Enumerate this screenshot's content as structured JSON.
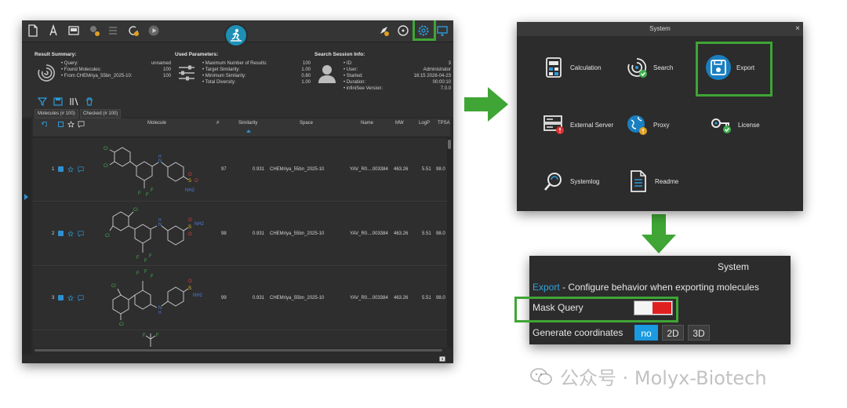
{
  "app": {
    "summary": {
      "result_heading": "Result Summary:",
      "result_rows": [
        {
          "key": "Query:",
          "value": "unnamed"
        },
        {
          "key": "Found Molecules:",
          "value": "100"
        },
        {
          "key": "From CHEMriya_55bn_2025-10:",
          "value": "100"
        }
      ],
      "params_heading": "Used Parameters:",
      "params_rows": [
        {
          "key": "Maximum Number of Results:",
          "value": "100"
        },
        {
          "key": "Target Similarity:",
          "value": "1.00"
        },
        {
          "key": "Minimum Similarity:",
          "value": "0.80"
        },
        {
          "key": "Total Diversity:",
          "value": "1.00"
        }
      ],
      "session_heading": "Search Session Info:",
      "session_rows": [
        {
          "key": "ID:",
          "value": "3"
        },
        {
          "key": "User:",
          "value": "Administrator"
        },
        {
          "key": "Started:",
          "value": "16:15 2026-04-23"
        },
        {
          "key": "Duration:",
          "value": "00:00:10"
        },
        {
          "key": "infiniSee Version:",
          "value": "7.0.0"
        }
      ]
    },
    "tabs": [
      "Molecules (# 100)",
      "Checked (# 100)"
    ],
    "columns": {
      "molecule": "Molecule",
      "index": "#",
      "similarity": "Similarity",
      "space": "Space",
      "name": "Name",
      "mw": "MW",
      "logp": "LogP",
      "tpsa": "TPSA"
    },
    "rows": [
      {
        "row_no": "1",
        "index": "97",
        "similarity": "0.931",
        "space": "CHEMriya_55bn_2025-10",
        "name": "YAV_R0....003384",
        "mw": "463.26",
        "logp": "5.51",
        "tpsa": "98.0"
      },
      {
        "row_no": "2",
        "index": "98",
        "similarity": "0.931",
        "space": "CHEMriya_55bn_2025-10",
        "name": "YAV_R0....003384",
        "mw": "463.26",
        "logp": "5.51",
        "tpsa": "98.0"
      },
      {
        "row_no": "3",
        "index": "99",
        "similarity": "0.931",
        "space": "CHEMriya_55bn_2025-10",
        "name": "YAV_R0....003384",
        "mw": "463.26",
        "logp": "5.51",
        "tpsa": "98.0"
      }
    ],
    "mol_labels": {
      "cl": "Cl",
      "f": "F",
      "n": "N",
      "h": "H",
      "s": "S",
      "o": "O",
      "nh2": "NH2"
    }
  },
  "system_dialog": {
    "title": "System",
    "close": "×",
    "items": [
      {
        "label": "Calculation",
        "icon": "calculator-icon"
      },
      {
        "label": "Search",
        "icon": "search-swirl-icon"
      },
      {
        "label": "Export",
        "icon": "floppy-disk-icon"
      },
      {
        "label": "External Server",
        "icon": "server-icon"
      },
      {
        "label": "Proxy",
        "icon": "globe-icon"
      },
      {
        "label": "License",
        "icon": "key-icon"
      },
      {
        "label": "Systemlog",
        "icon": "magnifier-icon"
      },
      {
        "label": "Readme",
        "icon": "document-icon"
      }
    ]
  },
  "export_panel": {
    "title": "System",
    "desc_link": "Export",
    "desc_text": " - Configure behavior when exporting molecules",
    "mask_query_label": "Mask Query",
    "mask_query_on": true,
    "generate_label": "Generate coordinates",
    "options": [
      "no",
      "2D",
      "3D"
    ],
    "selected": "no"
  },
  "watermark": {
    "text": "公众号 · Molyx-Biotech"
  },
  "colors": {
    "highlight_green": "#3fa535",
    "accent_blue": "#1a9ae0",
    "toggle_red": "#e02020"
  }
}
